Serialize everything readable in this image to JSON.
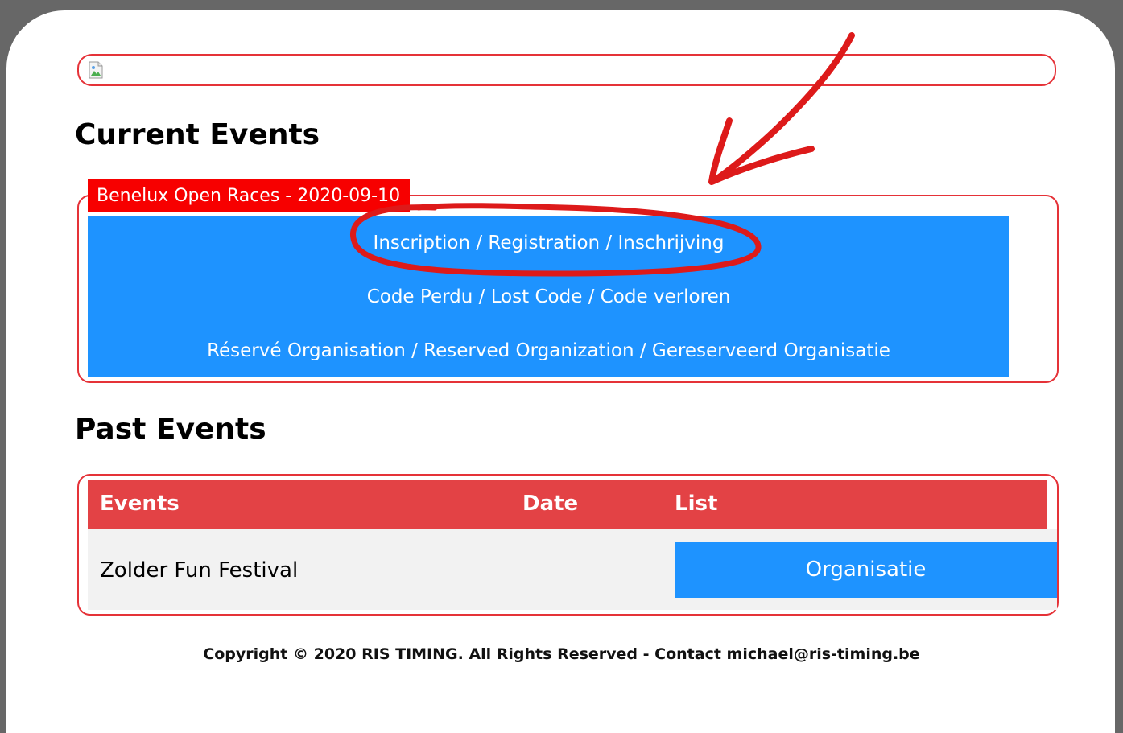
{
  "current_events": {
    "title": "Current Events",
    "event": {
      "name_date": "Benelux Open Races - 2020-09-10",
      "links": [
        "Inscription / Registration / Inschrijving",
        "Code Perdu / Lost Code / Code verloren",
        "Réservé Organisation / Reserved Organization / Gereserveerd Organisatie"
      ]
    }
  },
  "past_events": {
    "title": "Past Events",
    "columns": [
      "Events",
      "Date",
      "List"
    ],
    "rows": [
      {
        "event": "Zolder Fun Festival",
        "date": "",
        "list_button": "Organisatie"
      }
    ]
  },
  "footer": {
    "text": "Copyright © 2020 RIS TIMING. All Rights Reserved - Contact michael@ris-timing.be"
  },
  "colors": {
    "accent_red": "#e53238",
    "legend_red": "#f70000",
    "header_red": "#e34245",
    "link_blue": "#1e93ff",
    "annotation_red": "#dd1a1a"
  },
  "icons": {
    "banner": "broken-image-icon"
  }
}
